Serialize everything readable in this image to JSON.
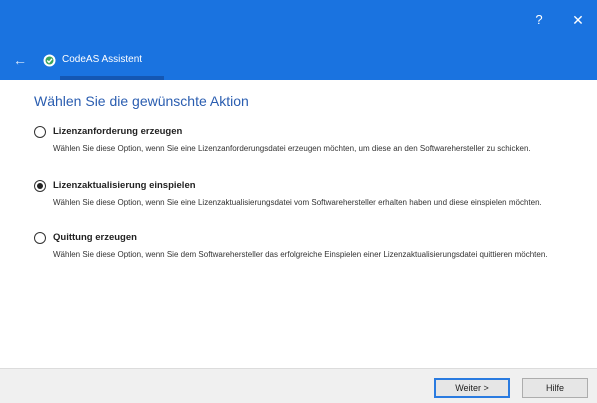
{
  "window": {
    "help_glyph": "?",
    "close_glyph": "✕",
    "back_glyph": "←",
    "app_title": "CodeAS Assistent",
    "accent_color": "#1a73e0"
  },
  "main": {
    "heading": "Wählen Sie die gewünschte Aktion",
    "options": [
      {
        "label": "Lizenzanforderung erzeugen",
        "description": "Wählen Sie diese Option, wenn Sie eine Lizenzanforderungsdatei erzeugen möchten, um diese an den Softwarehersteller zu schicken.",
        "selected": false
      },
      {
        "label": "Lizenzaktualisierung einspielen",
        "description": "Wählen Sie diese Option, wenn Sie eine Lizenzaktualisierungsdatei vom Softwarehersteller erhalten haben und diese einspielen möchten.",
        "selected": true
      },
      {
        "label": "Quittung erzeugen",
        "description": "Wählen Sie diese Option, wenn Sie dem Softwarehersteller das erfolgreiche Einspielen einer Lizenzaktualisierungsdatei quittieren möchten.",
        "selected": false
      }
    ]
  },
  "footer": {
    "next_label": "Weiter >",
    "help_label": "Hilfe"
  }
}
